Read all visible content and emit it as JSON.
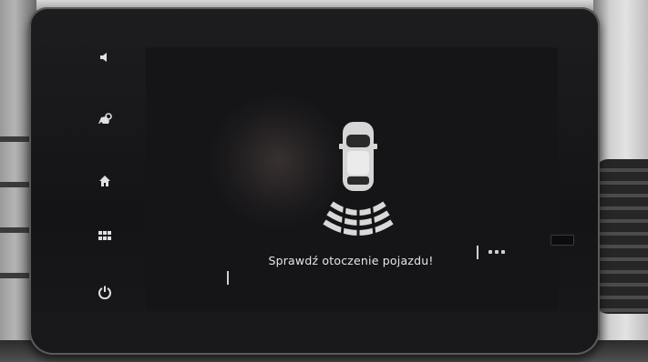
{
  "screen": {
    "alert_message": "Sprawdź otoczenie pojazdu!"
  },
  "sidebar": {
    "items": [
      {
        "icon": "volume-icon"
      },
      {
        "icon": "driving-assist-icon"
      },
      {
        "icon": "home-icon"
      },
      {
        "icon": "apps-grid-icon"
      },
      {
        "icon": "power-icon"
      }
    ]
  },
  "colors": {
    "screen_bg": "#151517",
    "text": "#e6e6e6",
    "bezel": "#1a1a1c"
  }
}
